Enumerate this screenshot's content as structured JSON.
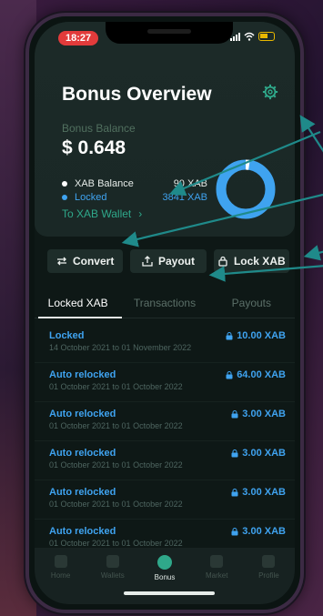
{
  "status": {
    "time": "18:27"
  },
  "header": {
    "title": "Bonus Overview"
  },
  "balance": {
    "label": "Bonus Balance",
    "value": "$ 0.648",
    "legend": [
      {
        "label": "XAB Balance",
        "value": "90 XAB",
        "color": "#ffffff"
      },
      {
        "label": "Locked",
        "value": "3841 XAB",
        "color": "#3fa3f0"
      }
    ],
    "wallet_link": "To XAB Wallet",
    "wallet_link_chevron": "›",
    "donut_locked_fraction": 0.977
  },
  "actions": [
    {
      "label": "Convert",
      "icon": "swap-icon"
    },
    {
      "label": "Payout",
      "icon": "upload-icon"
    },
    {
      "label": "Lock XAB",
      "icon": "lock-icon"
    }
  ],
  "tabs": [
    {
      "label": "Locked XAB",
      "active": true
    },
    {
      "label": "Transactions",
      "active": false
    },
    {
      "label": "Payouts",
      "active": false
    }
  ],
  "rows": [
    {
      "title": "Locked",
      "date": "14 October 2021 to 01 November 2022",
      "amount": "10.00 XAB"
    },
    {
      "title": "Auto relocked",
      "date": "01 October 2021 to 01 October 2022",
      "amount": "64.00 XAB"
    },
    {
      "title": "Auto relocked",
      "date": "01 October 2021 to 01 October 2022",
      "amount": "3.00 XAB"
    },
    {
      "title": "Auto relocked",
      "date": "01 October 2021 to 01 October 2022",
      "amount": "3.00 XAB"
    },
    {
      "title": "Auto relocked",
      "date": "01 October 2021 to 01 October 2022",
      "amount": "3.00 XAB"
    },
    {
      "title": "Auto relocked",
      "date": "01 October 2021 to 01 October 2022",
      "amount": "3.00 XAB"
    }
  ],
  "nav": [
    {
      "label": "Home",
      "icon": "home-icon",
      "active": false
    },
    {
      "label": "Wallets",
      "icon": "wallet-icon",
      "active": false
    },
    {
      "label": "Bonus",
      "icon": "bonus-icon",
      "active": true
    },
    {
      "label": "Market",
      "icon": "chart-icon",
      "active": false
    },
    {
      "label": "Profile",
      "icon": "profile-icon",
      "active": false
    }
  ],
  "colors": {
    "accent": "#2fa88a",
    "locked": "#3fa3f0",
    "annotation": "#1f8a8a"
  }
}
